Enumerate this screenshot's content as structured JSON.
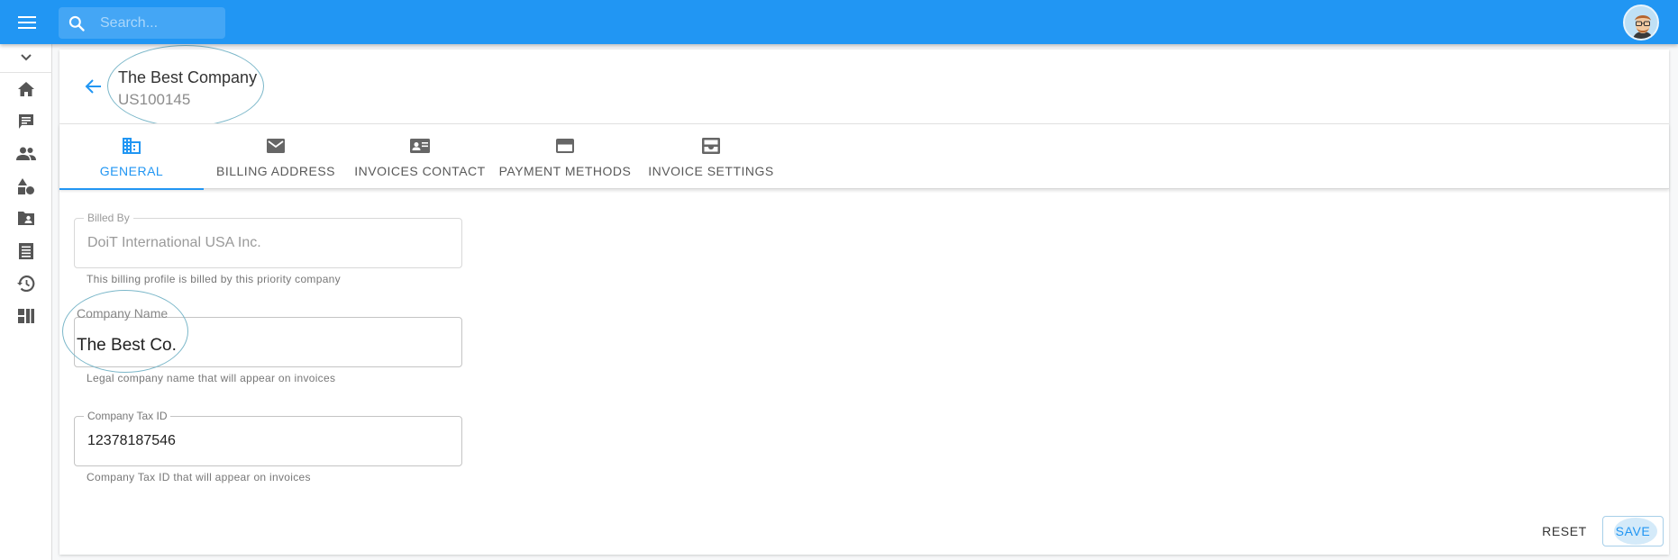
{
  "header": {
    "search_placeholder": "Search...",
    "icons": {
      "menu": "hamburger-menu-icon",
      "search": "search-icon",
      "avatar": "user-avatar"
    }
  },
  "sidebar": {
    "items": [
      {
        "icon": "chevron-down-icon"
      },
      {
        "icon": "home-icon"
      },
      {
        "icon": "chat-icon"
      },
      {
        "icon": "people-icon"
      },
      {
        "icon": "shapes-icon"
      },
      {
        "icon": "folder-account-icon"
      },
      {
        "icon": "list-document-icon"
      },
      {
        "icon": "history-icon"
      },
      {
        "icon": "dashboard-icon"
      }
    ]
  },
  "company": {
    "name": "The Best Company",
    "id": "US100145"
  },
  "tabs": [
    {
      "label": "General",
      "icon": "domain-icon",
      "active": true
    },
    {
      "label": "Billing Address",
      "icon": "mail-icon",
      "active": false
    },
    {
      "label": "Invoices Contact",
      "icon": "contact-card-icon",
      "active": false
    },
    {
      "label": "Payment Methods",
      "icon": "credit-card-icon",
      "active": false
    },
    {
      "label": "Invoice Settings",
      "icon": "inbox-icon",
      "active": false
    }
  ],
  "form": {
    "billed_by": {
      "label": "Billed By",
      "value": "DoiT International USA Inc.",
      "helper": "This billing profile is billed by this priority company"
    },
    "company_name": {
      "label": "Company Name",
      "value": "The Best Co.",
      "helper": "Legal company name that will appear on invoices"
    },
    "tax_id": {
      "label": "Company Tax ID",
      "value": "12378187546",
      "helper": "Company Tax ID that will appear on invoices"
    }
  },
  "actions": {
    "reset": "Reset",
    "save": "Save"
  },
  "colors": {
    "primary": "#2196f3",
    "annotation": "#7bb7c9"
  }
}
